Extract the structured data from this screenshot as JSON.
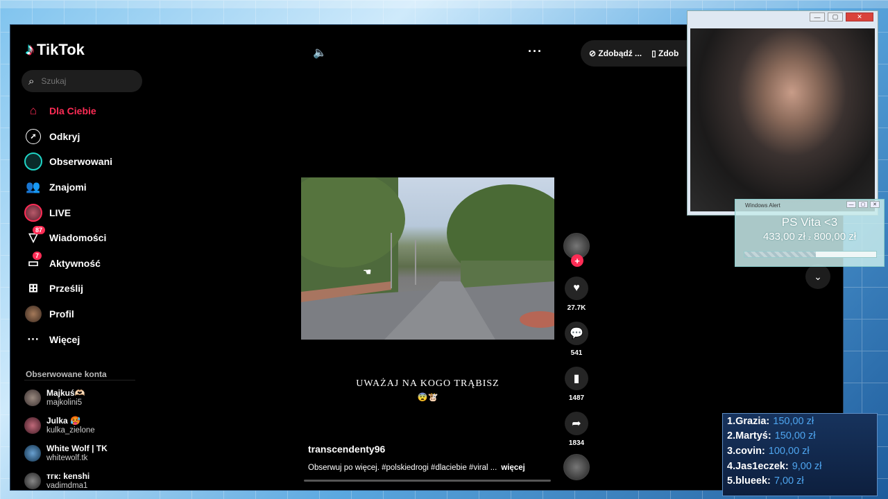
{
  "app": {
    "logo_text": "TikTok"
  },
  "search": {
    "placeholder": "Szukaj"
  },
  "nav": [
    {
      "label": "Dla Ciebie",
      "icon": "home-icon",
      "badge": ""
    },
    {
      "label": "Odkryj",
      "icon": "compass-icon",
      "badge": ""
    },
    {
      "label": "Obserwowani",
      "icon": "following-icon",
      "badge": ""
    },
    {
      "label": "Znajomi",
      "icon": "friends-icon",
      "badge": ""
    },
    {
      "label": "LIVE",
      "icon": "live-icon",
      "badge": ""
    },
    {
      "label": "Wiadomości",
      "icon": "messages-icon",
      "badge": "87"
    },
    {
      "label": "Aktywność",
      "icon": "activity-icon",
      "badge": "7"
    },
    {
      "label": "Prześlij",
      "icon": "upload-icon",
      "badge": ""
    },
    {
      "label": "Profil",
      "icon": "profile-icon",
      "badge": ""
    },
    {
      "label": "Więcej",
      "icon": "more-icon",
      "badge": ""
    }
  ],
  "following": {
    "title": "Obserwowane konta",
    "accounts": [
      {
        "name": "Majkuś🫶🏻",
        "handle": "majkolini5"
      },
      {
        "name": "Julka 🥵",
        "handle": "kulka_zielone"
      },
      {
        "name": "White Wolf | TK",
        "handle": "whitewolf.tk"
      },
      {
        "name": "тгк: kenshi",
        "handle": "vadimdma1"
      }
    ]
  },
  "topbar": {
    "btn1": "Zdobądź ...",
    "btn2": "Zdob"
  },
  "video": {
    "caption": "UWAŻAJ NA KOGO TRĄBISZ",
    "emoji": "😨🐮",
    "author": "transcendenty96",
    "description": "Obserwuj po więcej. #polskiedrogi #dlaciebie #viral ...",
    "more": "więcej"
  },
  "actions": {
    "likes": "27.7K",
    "comments": "541",
    "saves": "1487",
    "shares": "1834"
  },
  "overlay": {
    "alert_title": "Windows Alert",
    "goal_name": "PS Vita <3",
    "goal_current": "433,00 zł",
    "goal_sep": "z",
    "goal_target": "800,00 zł",
    "goal_progress": 0.54
  },
  "leaderboard": [
    {
      "rank": "1.",
      "name": "Grazia:",
      "amount": "150,00 zł"
    },
    {
      "rank": "2.",
      "name": "Martyś:",
      "amount": "150,00 zł"
    },
    {
      "rank": "3.",
      "name": "covin:",
      "amount": "100,00 zł"
    },
    {
      "rank": "4.",
      "name": "Jas1eczek:",
      "amount": "9,00 zł"
    },
    {
      "rank": "5.",
      "name": "blueek:",
      "amount": "7,00 zł"
    }
  ],
  "colors": {
    "accent": "#fe2c55",
    "teal": "#25f4ee",
    "leaderboard_amount": "#4ea5ef"
  }
}
